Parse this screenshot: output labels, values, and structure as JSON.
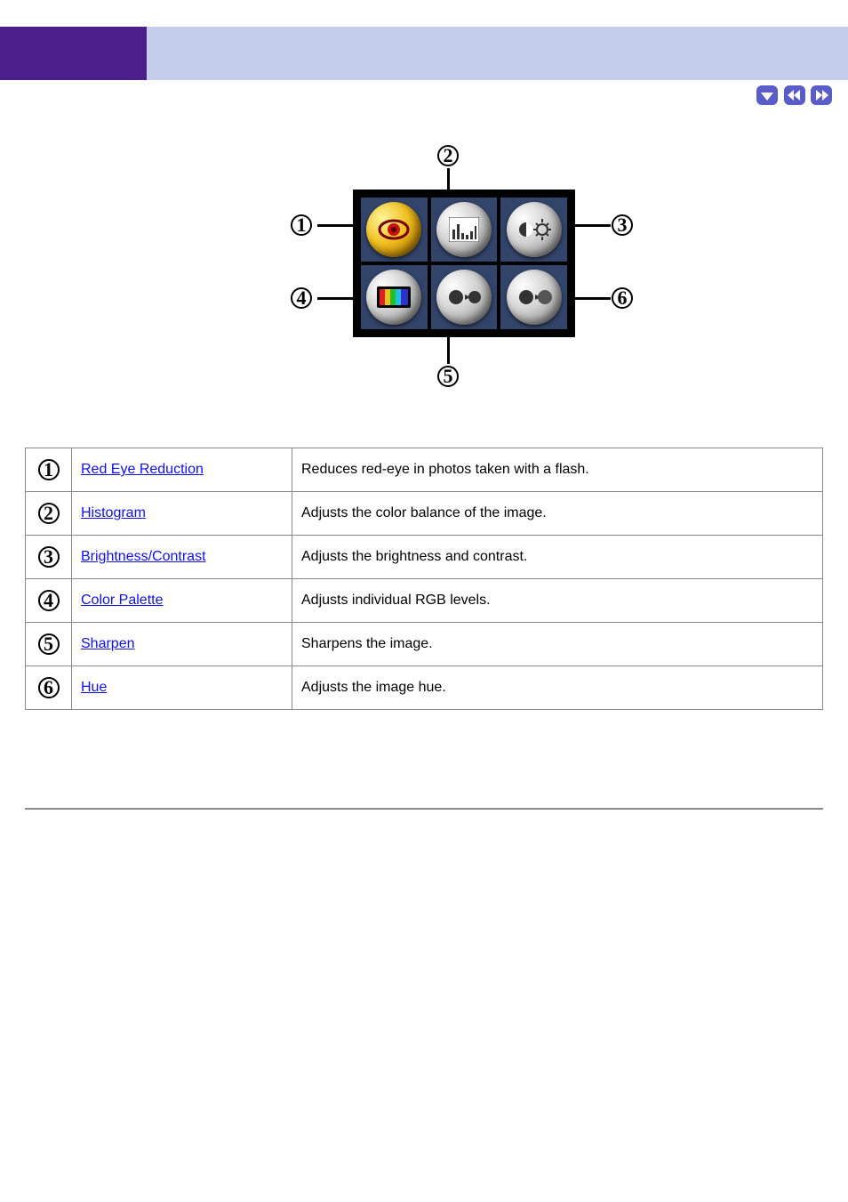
{
  "nav": {
    "down": "down-arrow",
    "prev": "prev-double",
    "next": "next-double"
  },
  "diagram": {
    "labels": {
      "n1": "1",
      "n2": "2",
      "n3": "3",
      "n4": "4",
      "n5": "5",
      "n6": "6"
    },
    "buttons": {
      "b1": {
        "icon": "redeye",
        "active": true
      },
      "b2": {
        "icon": "histogram",
        "active": false
      },
      "b3": {
        "icon": "brightness-contrast",
        "active": false
      },
      "b4": {
        "icon": "color-spectrum",
        "active": false
      },
      "b5": {
        "icon": "sharpen",
        "active": false
      },
      "b6": {
        "icon": "hue",
        "active": false
      }
    }
  },
  "table": {
    "rows": [
      {
        "num": "1",
        "link": "Red Eye Reduction",
        "desc": "Reduces red-eye in photos taken with a flash."
      },
      {
        "num": "2",
        "link": "Histogram",
        "desc": "Adjusts the color balance of the image."
      },
      {
        "num": "3",
        "link": "Brightness/Contrast",
        "desc": "Adjusts the brightness and contrast."
      },
      {
        "num": "4",
        "link": "Color Palette",
        "desc": "Adjusts individual RGB levels."
      },
      {
        "num": "5",
        "link": "Sharpen",
        "desc": "Sharpens the image."
      },
      {
        "num": "6",
        "link": "Hue",
        "desc": "Adjusts the image hue."
      }
    ]
  }
}
